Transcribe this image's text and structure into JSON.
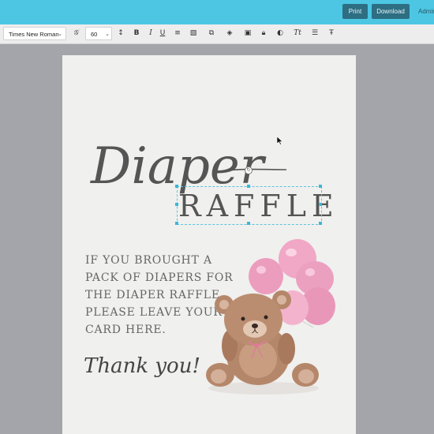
{
  "header": {
    "print_label": "Print",
    "download_label": "Download",
    "admin_label": "Admin"
  },
  "toolbar": {
    "font_family": "Times New Roman",
    "font_size": "60"
  },
  "design": {
    "script_word": "Diaper",
    "headline": "RAFFLE",
    "message_lines": [
      "IF YOU BROUGHT A",
      "PACK OF DIAPERS FOR",
      "THE DIAPER RAFFLE,",
      "PLEASE LEAVE YOUR",
      "CARD HERE."
    ],
    "signature": "Thank you!"
  },
  "colors": {
    "header_bg": "#4cc6e3",
    "button_bg": "#2d6e82",
    "canvas_bg": "#a3a5aa",
    "page_bg": "#f0f0ee",
    "text": "#555555",
    "selection": "#39b7d8",
    "balloon": "#f0a6c4",
    "bear": "#b5876a"
  }
}
